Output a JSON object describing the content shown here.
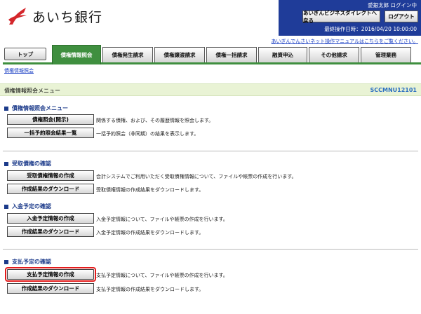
{
  "header": {
    "bank_name": "あいち銀行",
    "user_label": "愛銀太郎 ログイン中",
    "back_button": "あいぎんビジネスダイレクトへ戻る",
    "logout_button": "ログアウト",
    "last_operation": "最終操作日時：2016/04/20 10:00:00",
    "manual_link": "あいぎんでんさいネット操作マニュアルはこちらをご覧ください。"
  },
  "tabs": [
    {
      "label": "トップ",
      "active": false
    },
    {
      "label": "債権情報照会",
      "active": true
    },
    {
      "label": "債権発生請求",
      "active": false
    },
    {
      "label": "債権譲渡請求",
      "active": false
    },
    {
      "label": "債権一括請求",
      "active": false
    },
    {
      "label": "融資申込",
      "active": false
    },
    {
      "label": "その他請求",
      "active": false
    },
    {
      "label": "管理業務",
      "active": false
    }
  ],
  "breadcrumb": "債権情報照会",
  "title": {
    "text": "債権情報照会メニュー",
    "screen_id": "SCCMNU12101"
  },
  "sections": [
    {
      "heading": "債権情報照会メニュー",
      "items": [
        {
          "button": "債権照会(開示)",
          "description": "関係する債権、および、その履歴情報を照会します。"
        },
        {
          "button": "一括予約照会結果一覧",
          "description": "一括予約照会（非同期）の結果を表示します。"
        }
      ]
    },
    {
      "heading": "受取債権の確認",
      "items": [
        {
          "button": "受取債権情報の作成",
          "description": "会計システムでご利用いただく受取債権情報について、ファイルや帳票の作成を行います。"
        },
        {
          "button": "作成結果のダウンロード",
          "description": "受取債権情報の作成結果をダウンロードします。"
        }
      ]
    },
    {
      "heading": "入金予定の確認",
      "items": [
        {
          "button": "入金予定情報の作成",
          "description": "入金予定情報について、ファイルや帳票の作成を行います。"
        },
        {
          "button": "作成結果のダウンロード",
          "description": "入金予定情報の作成結果をダウンロードします。"
        }
      ]
    },
    {
      "heading": "支払予定の確認",
      "items": [
        {
          "button": "支払予定情報の作成",
          "description": "支払予定情報について、ファイルや帳票の作成を行います。"
        },
        {
          "button": "作成結果のダウンロード",
          "description": "支払予定情報の作成結果をダウンロードします。"
        }
      ]
    }
  ],
  "colors": {
    "header_blue": "#1f3c99",
    "tab_green": "#3f8f3f",
    "title_bar_bg": "#e9f3d5",
    "section_blue": "#1b3a8a",
    "screen_id_blue": "#2b6fc0",
    "highlight_red": "#e31b1b",
    "logo_red": "#d4262b"
  },
  "icons": {
    "logo": "aichi-bank-logo-icon",
    "section_marker": "square-bullet-icon"
  }
}
